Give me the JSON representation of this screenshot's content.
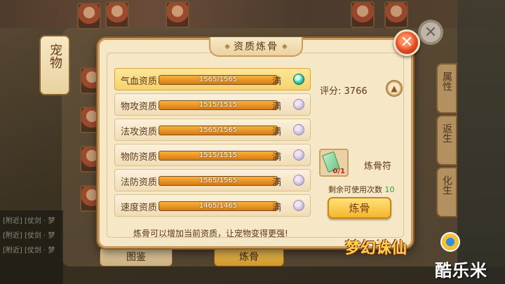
{
  "dialog": {
    "title": "资质炼骨",
    "close_label": "✕"
  },
  "stats": [
    {
      "label": "气血资质",
      "current": 1565,
      "max": 1565,
      "value_text": "1565/1565",
      "status": "满",
      "selected": true
    },
    {
      "label": "物攻资质",
      "current": 1515,
      "max": 1515,
      "value_text": "1515/1515",
      "status": "满",
      "selected": false
    },
    {
      "label": "法攻资质",
      "current": 1565,
      "max": 1565,
      "value_text": "1565/1565",
      "status": "满",
      "selected": false
    },
    {
      "label": "物防资质",
      "current": 1515,
      "max": 1515,
      "value_text": "1515/1515",
      "status": "满",
      "selected": false
    },
    {
      "label": "法防资质",
      "current": 1565,
      "max": 1565,
      "value_text": "1565/1565",
      "status": "满",
      "selected": false
    },
    {
      "label": "速度资质",
      "current": 1465,
      "max": 1465,
      "value_text": "1465/1465",
      "status": "满",
      "selected": false
    }
  ],
  "score": {
    "label": "评分:",
    "value": "3766"
  },
  "item": {
    "name": "炼骨符",
    "count": "0/1"
  },
  "remaining": {
    "label": "剩余可使用次数",
    "value": "10"
  },
  "refine_button": "炼骨",
  "note": "炼骨可以增加当前资质，让宠物变得更强!",
  "background": {
    "lantern_text": "宠物",
    "tabs": [
      "属性",
      "返生",
      "化生"
    ],
    "atlas_button": "图鉴",
    "bone_button": "炼骨",
    "chat_lines": [
      "[附近] [仗剑 · 梦",
      "[附近] [仗剑 · 梦",
      "[附近] [仗剑 · 梦"
    ]
  },
  "logos": {
    "game": "梦幻诛仙",
    "site": "酷乐米"
  },
  "colors": {
    "accent": "#f6b62b",
    "selected_row": "#f7d26a",
    "close": "#e14a26"
  }
}
